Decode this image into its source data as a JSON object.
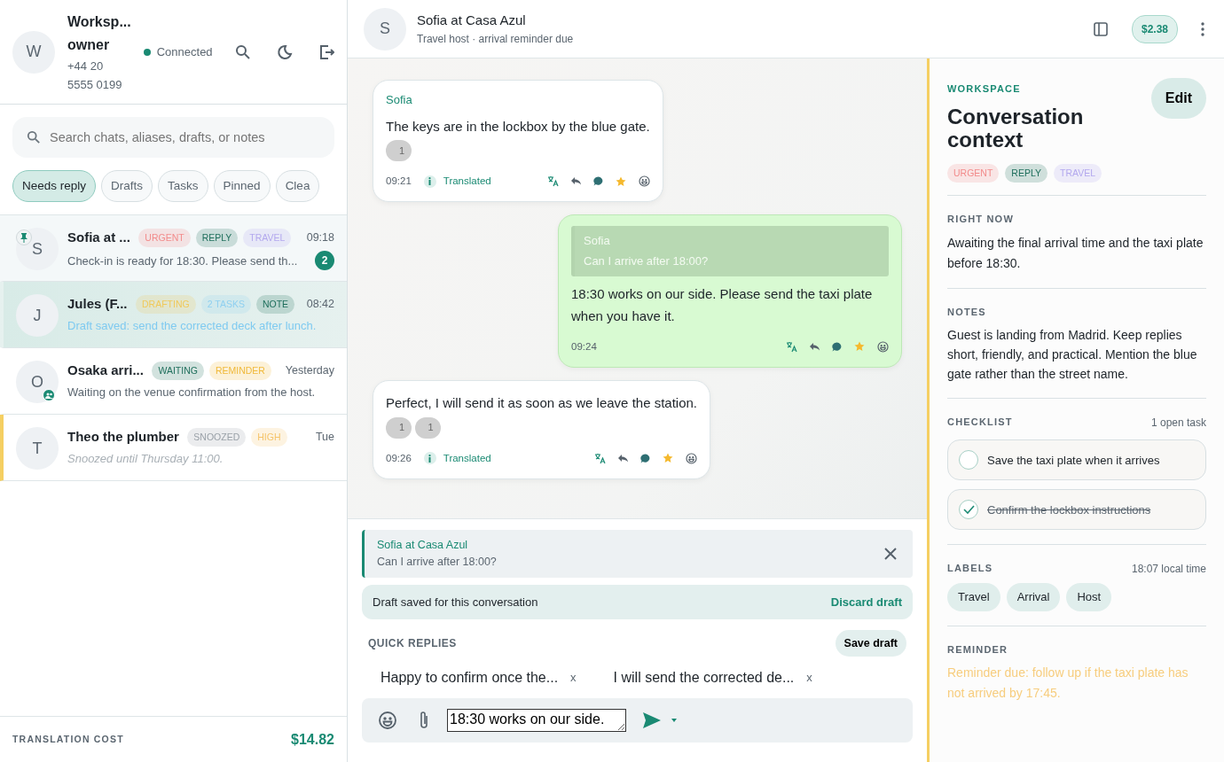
{
  "account": {
    "avatar": "W",
    "name": "Worksp... owner",
    "phone": "+44 20 5555 0199",
    "status": "Connected",
    "connected": true
  },
  "search": {
    "placeholder": "Search chats, aliases, drafts, or notes"
  },
  "filters": [
    {
      "label": "Needs reply",
      "selected": true
    },
    {
      "label": "Drafts",
      "selected": false
    },
    {
      "label": "Tasks",
      "selected": false
    },
    {
      "label": "Pinned",
      "selected": false
    },
    {
      "label": "Clea",
      "selected": false
    }
  ],
  "chats": [
    {
      "avatar": "S",
      "name": "Sofia at ...",
      "tags": [
        {
          "label": "URGENT",
          "color": "#f28b8b"
        },
        {
          "label": "REPLY",
          "color": "#1f6f5c"
        },
        {
          "label": "TRAVEL",
          "color": "#b3a8ee"
        }
      ],
      "time": "09:18",
      "preview": "Check-in is ready for 18:30. Please send th...",
      "draft": false,
      "pinned": true,
      "group": false,
      "snoozed": false,
      "selected": false,
      "unread": "2"
    },
    {
      "avatar": "J",
      "name": "Jules (F...",
      "tags": [
        {
          "label": "DRAFTING",
          "color": "#f0c95a"
        },
        {
          "label": "2 TASKS",
          "color": "#8fd0f0"
        },
        {
          "label": "NOTE",
          "color": "#1f6f5c"
        }
      ],
      "time": "08:42",
      "preview": "Draft saved: send the corrected deck after lunch.",
      "draft": true,
      "pinned": false,
      "group": false,
      "snoozed": false,
      "selected": true
    },
    {
      "avatar": "O",
      "name": "Osaka arri...",
      "tags": [
        {
          "label": "WAITING",
          "color": "#1f6f5c"
        },
        {
          "label": "REMINDER",
          "color": "#f0b93a"
        }
      ],
      "time": "Yesterday",
      "preview": "Waiting on the venue confirmation from the host.",
      "draft": false,
      "pinned": false,
      "group": true,
      "snoozed": false,
      "selected": false
    },
    {
      "avatar": "T",
      "name": "Theo the plumber",
      "tags": [
        {
          "label": "SNOOZED",
          "color": "#9aa1a8"
        },
        {
          "label": "HIGH",
          "color": "#f5c46a"
        }
      ],
      "time": "Tue",
      "preview": "Snoozed until Thursday 11:00.",
      "draft": false,
      "pinned": false,
      "group": false,
      "snoozed": true,
      "selected": false
    }
  ],
  "footer": {
    "label": "TRANSLATION COST",
    "value": "$14.82"
  },
  "conversation": {
    "avatar": "S",
    "title": "Sofia at Casa Azul",
    "subtitle": "Travel host · arrival reminder due",
    "cost": "$2.38"
  },
  "messages": [
    {
      "kind": "incoming",
      "sender": "Sofia",
      "text": "The keys are in the lockbox by the blue gate.",
      "reactions": [
        "1"
      ],
      "time": "09:21",
      "translated": "Translated"
    },
    {
      "kind": "outgoing",
      "quote": {
        "sender": "Sofia",
        "text": "Can I arrive after 18:00?"
      },
      "text": "18:30 works on our side. Please send the taxi plate when you have it.",
      "time": "09:24"
    },
    {
      "kind": "incoming",
      "text": "Perfect, I will send it as soon as we leave the station.",
      "reactions": [
        "1",
        "1"
      ],
      "time": "09:26",
      "translated": "Translated"
    }
  ],
  "composer": {
    "reply_to": {
      "sender": "Sofia at Casa Azul",
      "text": "Can I arrive after 18:00?"
    },
    "draft_notice": "Draft saved for this conversation",
    "discard": "Discard draft",
    "quick_replies_label": "QUICK REPLIES",
    "save_draft": "Save draft",
    "quick_replies": [
      {
        "text": "Happy to confirm once the...",
        "remove": "x"
      },
      {
        "text": "I will send the corrected de...",
        "remove": "x"
      }
    ],
    "value": "18:30 works on our side."
  },
  "context": {
    "eyebrow": "WORKSPACE",
    "title": "Conversation context",
    "edit": "Edit",
    "tags": [
      {
        "label": "URGENT",
        "color": "#f28b8b"
      },
      {
        "label": "REPLY",
        "color": "#1f6f5c"
      },
      {
        "label": "TRAVEL",
        "color": "#b3a8ee"
      }
    ],
    "right_now": {
      "heading": "RIGHT NOW",
      "text": "Awaiting the final arrival time and the taxi plate before 18:30."
    },
    "notes": {
      "heading": "NOTES",
      "text": "Guest is landing from Madrid. Keep replies short, friendly, and practical. Mention the blue gate rather than the street name."
    },
    "checklist": {
      "heading": "CHECKLIST",
      "count": "1 open task",
      "items": [
        {
          "label": "Save the taxi plate when it arrives",
          "checked": false
        },
        {
          "label": "Confirm the lockbox instructions",
          "checked": true
        }
      ]
    },
    "labels": {
      "heading": "LABELS",
      "time": "18:07 local time",
      "items": [
        "Travel",
        "Arrival",
        "Host"
      ]
    },
    "reminder": {
      "heading": "REMINDER",
      "text": "Reminder due: follow up if the taxi plate has not arrived by 17:45."
    }
  }
}
